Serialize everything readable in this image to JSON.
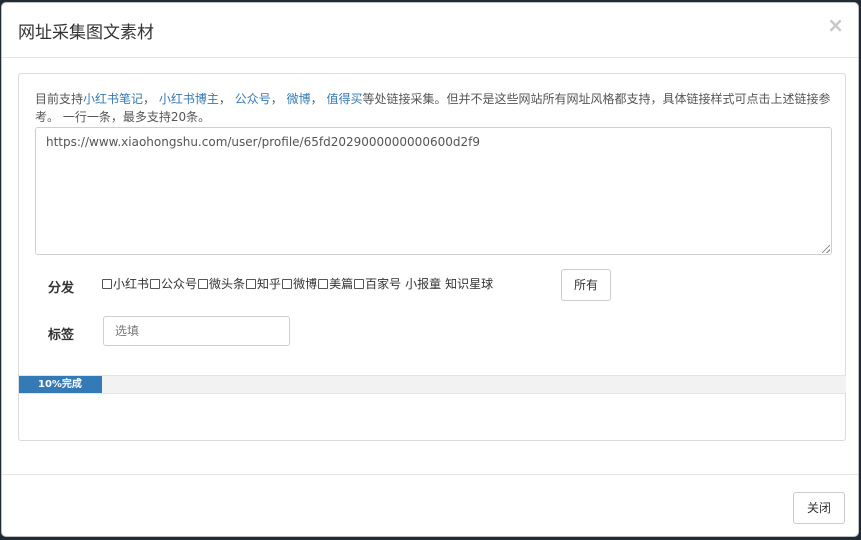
{
  "modal": {
    "title": "网址采集图文素材",
    "close_symbol": "×"
  },
  "description": {
    "prefix": "目前支持",
    "links": [
      "小红书笔记",
      "小红书博主",
      "公众号",
      "微博",
      "值得买"
    ],
    "separator": "，",
    "suffix": "等处链接采集。但并不是这些网站所有网址风格都支持，具体链接样式可点击上述链接参考。 一行一条，最多支持20条。"
  },
  "url_input": {
    "value": "https://www.xiaohongshu.com/user/profile/65fd2029000000000600d2f9"
  },
  "distribute": {
    "label": "分发",
    "checkbox_options": [
      "小红书",
      "公众号",
      "微头条",
      "知乎",
      "微博",
      "美篇",
      "百家号"
    ],
    "plain_options": [
      "小报童",
      "知识星球"
    ],
    "all_button": "所有"
  },
  "tags": {
    "label": "标签",
    "placeholder": "选填"
  },
  "progress": {
    "label": "10%完成",
    "percent": 10,
    "color": "#337ab7"
  },
  "footer": {
    "close_button": "关闭"
  }
}
